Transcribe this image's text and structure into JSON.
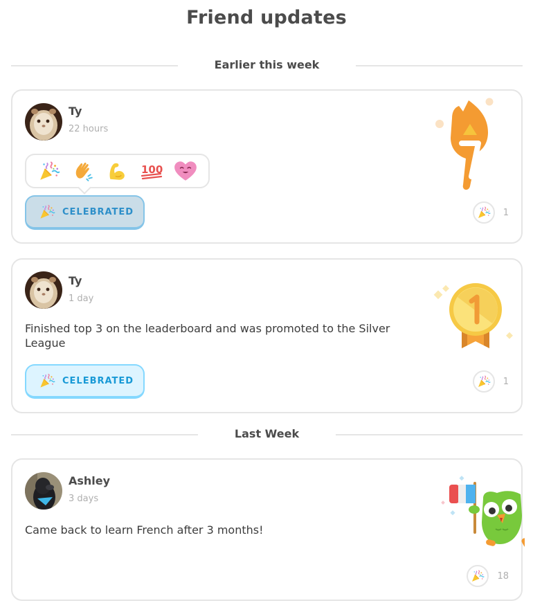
{
  "page": {
    "title": "Friend updates"
  },
  "sections": [
    {
      "label": "Earlier this week",
      "cards": [
        {
          "user_name": "Ty",
          "time_ago": "22 hours",
          "text": "",
          "illustration": "streak-flame-7-icon",
          "illustration_number": "7",
          "celebrate_label": "CELEBRATED",
          "celebrate_state": "active",
          "reaction_picker_open": true,
          "reaction_count": "1"
        },
        {
          "user_name": "Ty",
          "time_ago": "1 day",
          "text": "Finished top 3 on the leaderboard and was promoted to the Silver League",
          "illustration": "gold-medal-1-icon",
          "illustration_number": "1",
          "celebrate_label": "CELEBRATED",
          "celebrate_state": "normal",
          "reaction_count": "1"
        }
      ]
    },
    {
      "label": "Last Week",
      "cards": [
        {
          "user_name": "Ashley",
          "time_ago": "3 days",
          "text": "Came back to learn French after 3 months!",
          "illustration": "owl-with-french-flag-icon",
          "reaction_count": "18"
        }
      ]
    }
  ],
  "reaction_picker": {
    "reactions": [
      {
        "name": "party-popper"
      },
      {
        "name": "clapping-hands"
      },
      {
        "name": "flexed-biceps"
      },
      {
        "name": "hundred-points"
      },
      {
        "name": "smiling-heart"
      }
    ]
  },
  "colors": {
    "text_primary": "#4b4b4b",
    "text_muted": "#afafaf",
    "border": "#e5e5e5",
    "celebrate_blue": "#1899d6",
    "celebrate_bg": "#ddf4ff",
    "flame_orange": "#f49b32",
    "medal_gold": "#f6c945",
    "owl_green": "#78c93c"
  }
}
